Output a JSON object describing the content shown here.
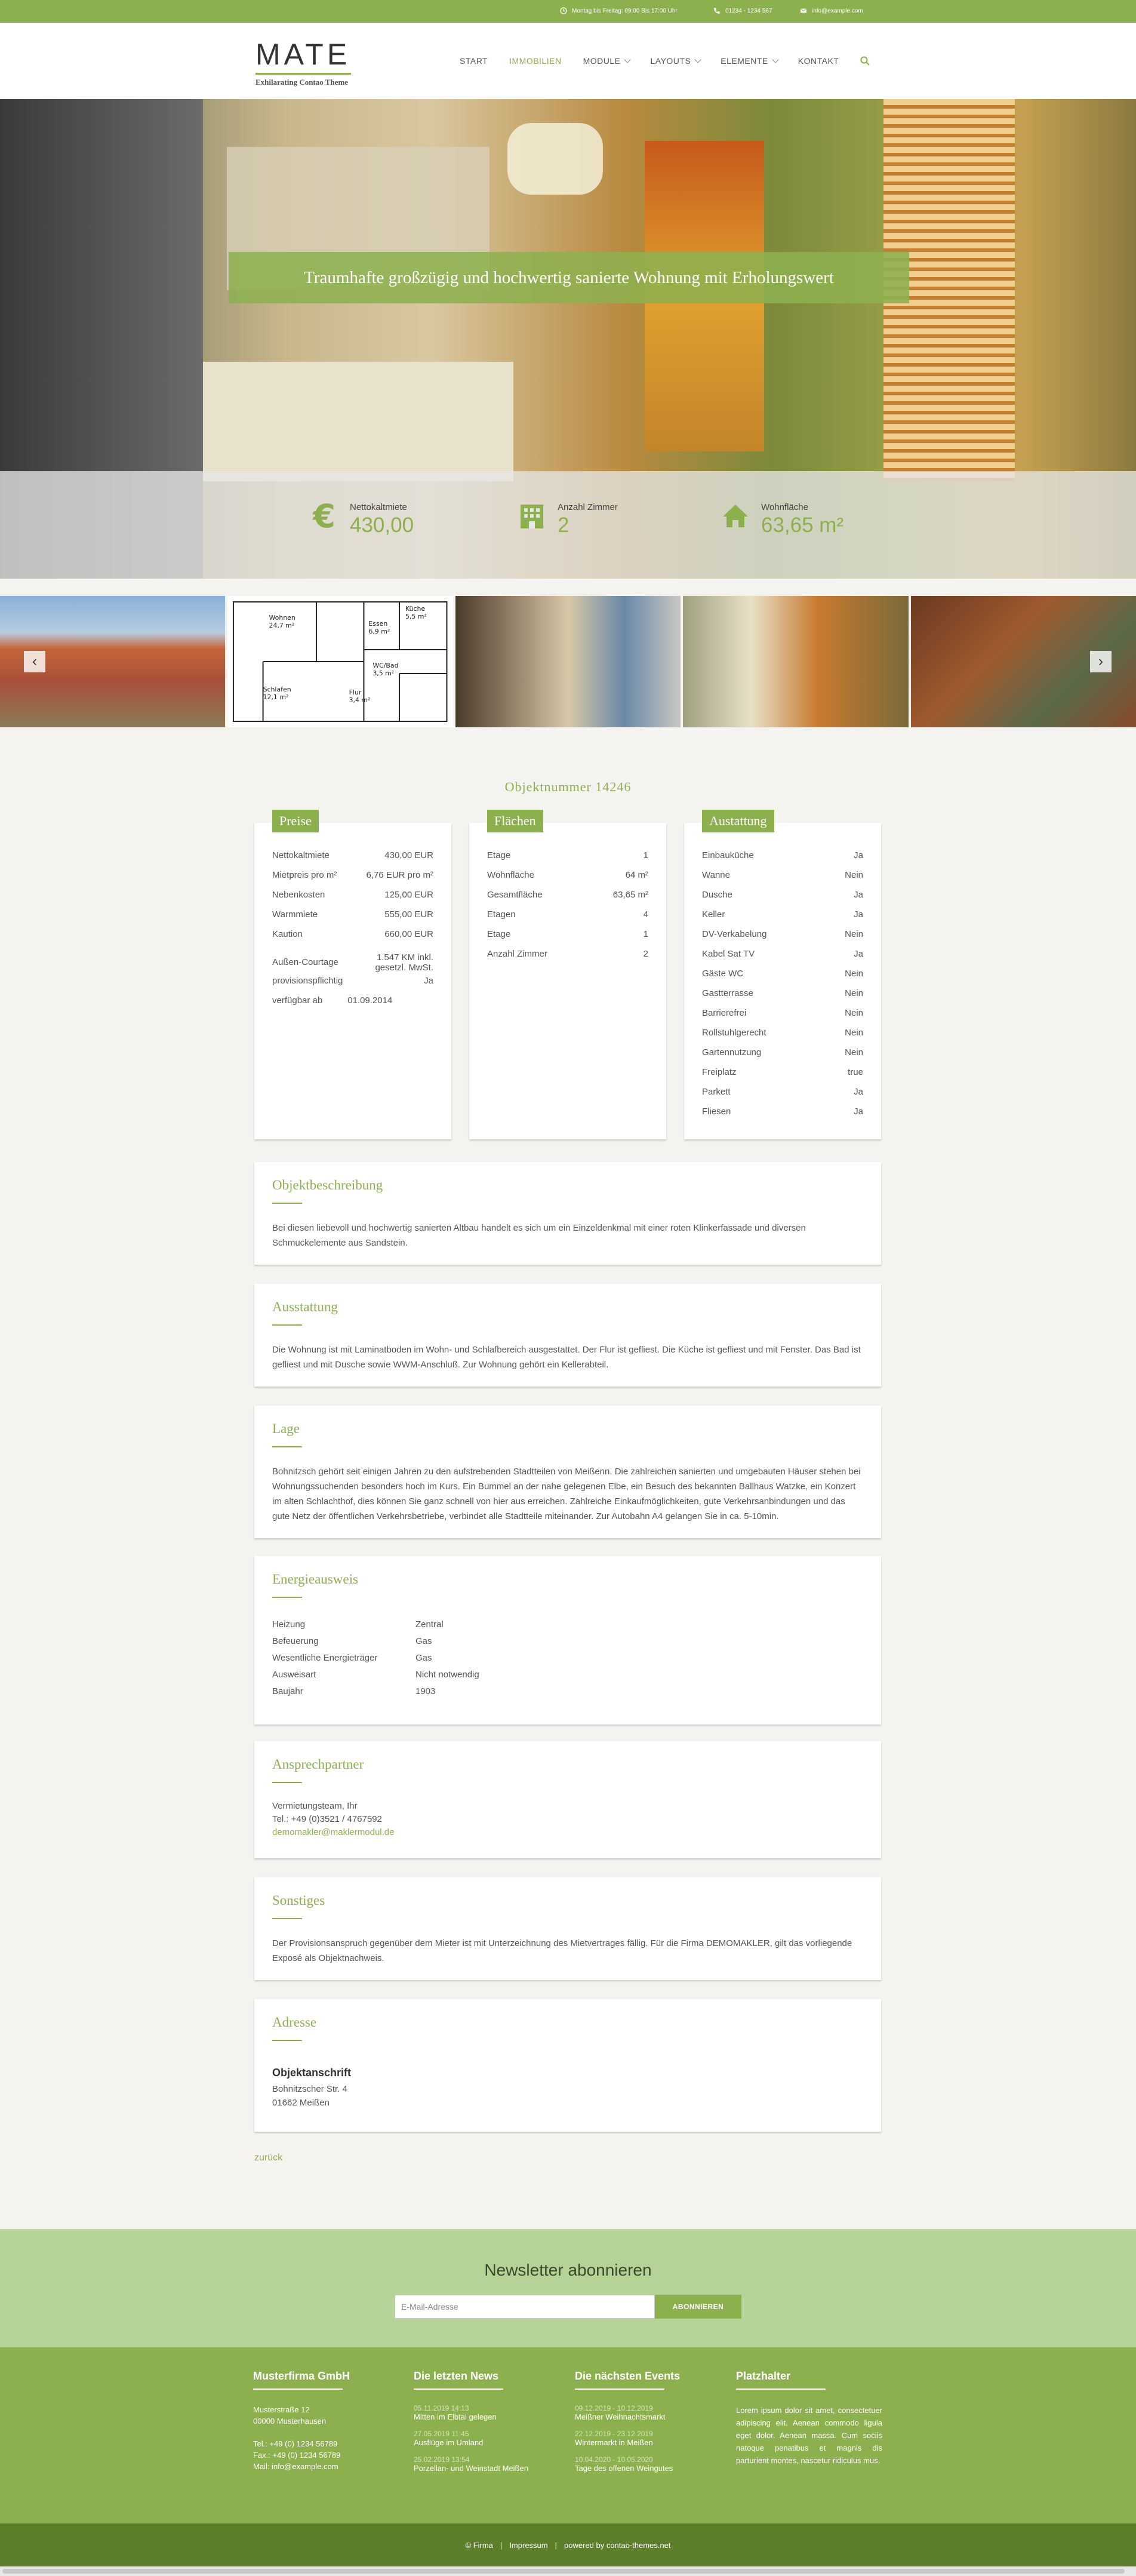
{
  "topbar": {
    "hours": "Montag bis Freitag: 09:00 Bis 17:00 Uhr",
    "phone": "01234 - 1234 567",
    "email": "info@example.com"
  },
  "header": {
    "logo": "MATE",
    "tagline": "Exhilarating Contao Theme",
    "nav": [
      {
        "label": "START",
        "has_dropdown": false
      },
      {
        "label": "IMMOBILIEN",
        "has_dropdown": false,
        "active": true
      },
      {
        "label": "MODULE",
        "has_dropdown": true
      },
      {
        "label": "LAYOUTS",
        "has_dropdown": true
      },
      {
        "label": "ELEMENTE",
        "has_dropdown": true
      },
      {
        "label": "KONTAKT",
        "has_dropdown": false
      }
    ]
  },
  "hero": {
    "title": "Traumhafte großzügig und hochwertig sanierte Wohnung mit Erholungswert",
    "stats": [
      {
        "icon": "euro-icon",
        "label": "Nettokaltmiete",
        "value": "430,00"
      },
      {
        "icon": "building-icon",
        "label": "Anzahl Zimmer",
        "value": "2"
      },
      {
        "icon": "home-icon",
        "label": "Wohnfläche",
        "value": "63,65 m²"
      }
    ]
  },
  "gallery": {
    "floorplan_labels": [
      "Wohnen",
      "24,7 m²",
      "Küche",
      "5,5 m²",
      "Essen",
      "6,9 m²",
      "Schlafen",
      "12,1 m²",
      "WC/Bad",
      "3,5 m²",
      "Flur",
      "3,4 m²"
    ]
  },
  "objekt": {
    "number": "Objektnummer 14246",
    "preise": {
      "title": "Preise",
      "rows": [
        {
          "k": "Nettokaltmiete",
          "v": "430,00 EUR"
        },
        {
          "k": "Mietpreis pro m²",
          "v": "6,76 EUR pro m²"
        },
        {
          "k": "Nebenkosten",
          "v": "125,00 EUR"
        },
        {
          "k": "Warmmiete",
          "v": "555,00 EUR"
        },
        {
          "k": "Kaution",
          "v": "660,00 EUR"
        },
        {
          "k": "Außen-Courtage",
          "v": "1.547 KM inkl. gesetzl. MwSt."
        },
        {
          "k": "provisionspflichtig",
          "v": "Ja"
        },
        {
          "k": "verfügbar ab",
          "v": "01.09.2014"
        }
      ]
    },
    "flaechen": {
      "title": "Flächen",
      "rows": [
        {
          "k": "Etage",
          "v": "1"
        },
        {
          "k": "Wohnfläche",
          "v": "64 m²"
        },
        {
          "k": "Gesamtfläche",
          "v": "63,65 m²"
        },
        {
          "k": "Etagen",
          "v": "4"
        },
        {
          "k": "Etage",
          "v": "1"
        },
        {
          "k": "Anzahl Zimmer",
          "v": "2"
        }
      ]
    },
    "ausstattung_table": {
      "title": "Austattung",
      "rows": [
        {
          "k": "Einbauküche",
          "v": "Ja"
        },
        {
          "k": "Wanne",
          "v": "Nein"
        },
        {
          "k": "Dusche",
          "v": "Ja"
        },
        {
          "k": "Keller",
          "v": "Ja"
        },
        {
          "k": "DV-Verkabelung",
          "v": "Nein"
        },
        {
          "k": "Kabel Sat TV",
          "v": "Ja"
        },
        {
          "k": "Gäste WC",
          "v": "Nein"
        },
        {
          "k": "Gastterrasse",
          "v": "Nein"
        },
        {
          "k": "Barrierefrei",
          "v": "Nein"
        },
        {
          "k": "Rollstuhlgerecht",
          "v": "Nein"
        },
        {
          "k": "Gartennutzung",
          "v": "Nein"
        },
        {
          "k": "Freiplatz",
          "v": "true"
        },
        {
          "k": "Parkett",
          "v": "Ja"
        },
        {
          "k": "Fliesen",
          "v": "Ja"
        }
      ]
    },
    "beschreibung": {
      "title": "Objektbeschreibung",
      "text": "Bei diesen liebevoll und hochwertig sanierten Altbau handelt es sich um ein Einzeldenkmal mit einer roten Klinkerfassade und diversen Schmuckelemente aus Sandstein."
    },
    "ausstattung": {
      "title": "Ausstattung",
      "text": "Die Wohnung ist mit Laminatboden im Wohn- und Schlafbereich ausgestattet. Der Flur ist gefliest. Die Küche ist gefliest und mit Fenster. Das Bad ist gefliest und mit Dusche sowie WWM-Anschluß. Zur Wohnung gehört ein Kellerabteil."
    },
    "lage": {
      "title": "Lage",
      "text": "Bohnitzsch gehört seit einigen Jahren zu den aufstrebenden Stadtteilen von Meißenn. Die zahlreichen sanierten und umgebauten Häuser stehen bei Wohnungssuchenden besonders hoch im Kurs. Ein Bummel an der nahe gelegenen Elbe, ein Besuch des bekannten Ballhaus Watzke, ein Konzert im alten Schlachthof, dies können Sie ganz schnell von hier aus erreichen. Zahlreiche Einkaufmöglichkeiten, gute Verkehrsanbindungen und das gute Netz der öffentlichen Verkehrsbetriebe, verbindet alle Stadtteile miteinander. Zur Autobahn A4 gelangen Sie in ca. 5-10min."
    },
    "energie": {
      "title": "Energieausweis",
      "rows": [
        {
          "k": "Heizung",
          "v": "Zentral"
        },
        {
          "k": "Befeuerung",
          "v": "Gas"
        },
        {
          "k": "Wesentliche Energieträger",
          "v": "Gas"
        },
        {
          "k": "Ausweisart",
          "v": "Nicht notwendig"
        },
        {
          "k": "Baujahr",
          "v": "1903"
        }
      ]
    },
    "ansprechpartner": {
      "title": "Ansprechpartner",
      "name": "Vermietungsteam, Ihr",
      "tel": "Tel.: +49 (0)3521 / 4767592",
      "email": "demomakler@maklermodul.de"
    },
    "sonstiges": {
      "title": "Sonstiges",
      "text": "Der Provisionsanspruch gegenüber dem Mieter ist mit Unterzeichnung des Mietvertrages fällig. Für die Firma DEMOMAKLER, gilt das vorliegende Exposé als Objektnachweis."
    },
    "adresse": {
      "title": "Adresse",
      "subtitle": "Objektanschrift",
      "street": "Bohnitzscher Str. 4",
      "city": "01662 Meißen"
    },
    "back": "zurück"
  },
  "newsletter": {
    "title": "Newsletter abonnieren",
    "placeholder": "E-Mail-Adresse",
    "button": "ABONNIEREN"
  },
  "footer": {
    "firma": {
      "title": "Musterfirma GmbH",
      "lines": [
        "Musterstraße 12",
        "00000 Musterhausen",
        "",
        "Tel.: +49 (0) 1234 56789",
        "Fax.: +49 (0) 1234 56789",
        "Mail: info@example.com"
      ]
    },
    "news": {
      "title": "Die letzten News",
      "items": [
        {
          "date": "05.11.2019 14:13",
          "title": "Mitten im Elbtal gelegen"
        },
        {
          "date": "27.05.2019 11:45",
          "title": "Ausflüge im Umland"
        },
        {
          "date": "25.02.2019 13:54",
          "title": "Porzellan- und Weinstadt Meißen"
        }
      ]
    },
    "events": {
      "title": "Die nächsten Events",
      "items": [
        {
          "date": "09.12.2019 - 10.12.2019",
          "title": "Meißner Weihnachtsmarkt"
        },
        {
          "date": "22.12.2019 - 23.12.2019",
          "title": "Wintermarkt in Meißen"
        },
        {
          "date": "10.04.2020 - 10.05.2020",
          "title": "Tage des offenen Weingutes"
        }
      ]
    },
    "platzhalter": {
      "title": "Platzhalter",
      "text": "Lorem ipsum dolor sit amet, consectetuer adipiscing elit. Aenean commodo ligula eget dolor. Aenean massa. Cum sociis natoque penatibus et magnis dis parturient montes, nascetur ridiculus mus."
    },
    "bottom": {
      "firma": "© Firma",
      "impressum": "Impressum",
      "powered": "powered by contao-themes.net"
    }
  },
  "colors": {
    "accent": "#8db04f",
    "footer_dark": "#5e7f2a",
    "newsletter_bg": "#b6d397"
  }
}
